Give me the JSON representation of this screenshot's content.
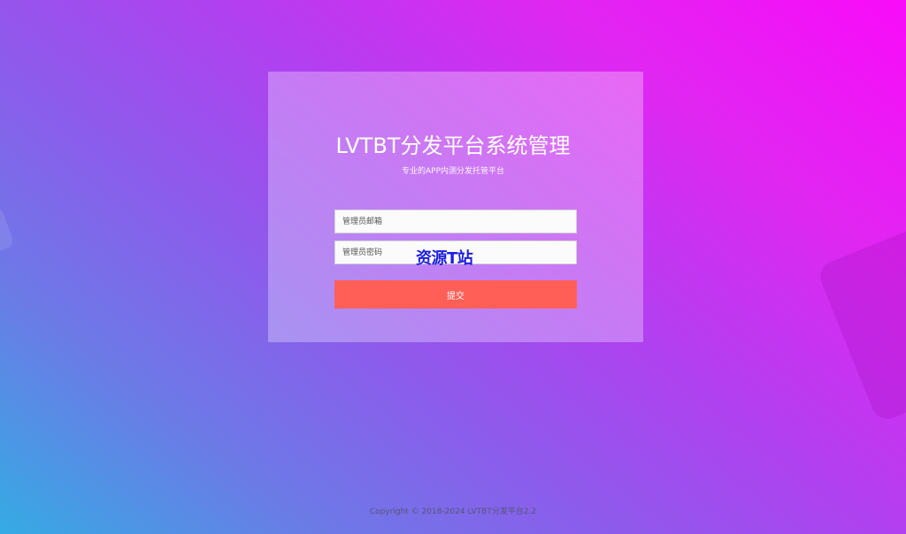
{
  "login": {
    "title": "LVTBT分发平台系统管理",
    "subtitle": "专业的APP内测分发托管平台",
    "email_placeholder": "管理员邮箱",
    "password_placeholder": "管理员密码",
    "submit_label": "提交"
  },
  "watermark": {
    "text": "资源T站"
  },
  "footer": {
    "copyright": "Copyright © 2018-2024 LVTBT分发平台2.2"
  },
  "colors": {
    "background_top_right": "#f90bf9",
    "background_bottom_left": "#35abe4",
    "submit_button": "#ff5f57",
    "watermark": "#1f1fe0"
  }
}
